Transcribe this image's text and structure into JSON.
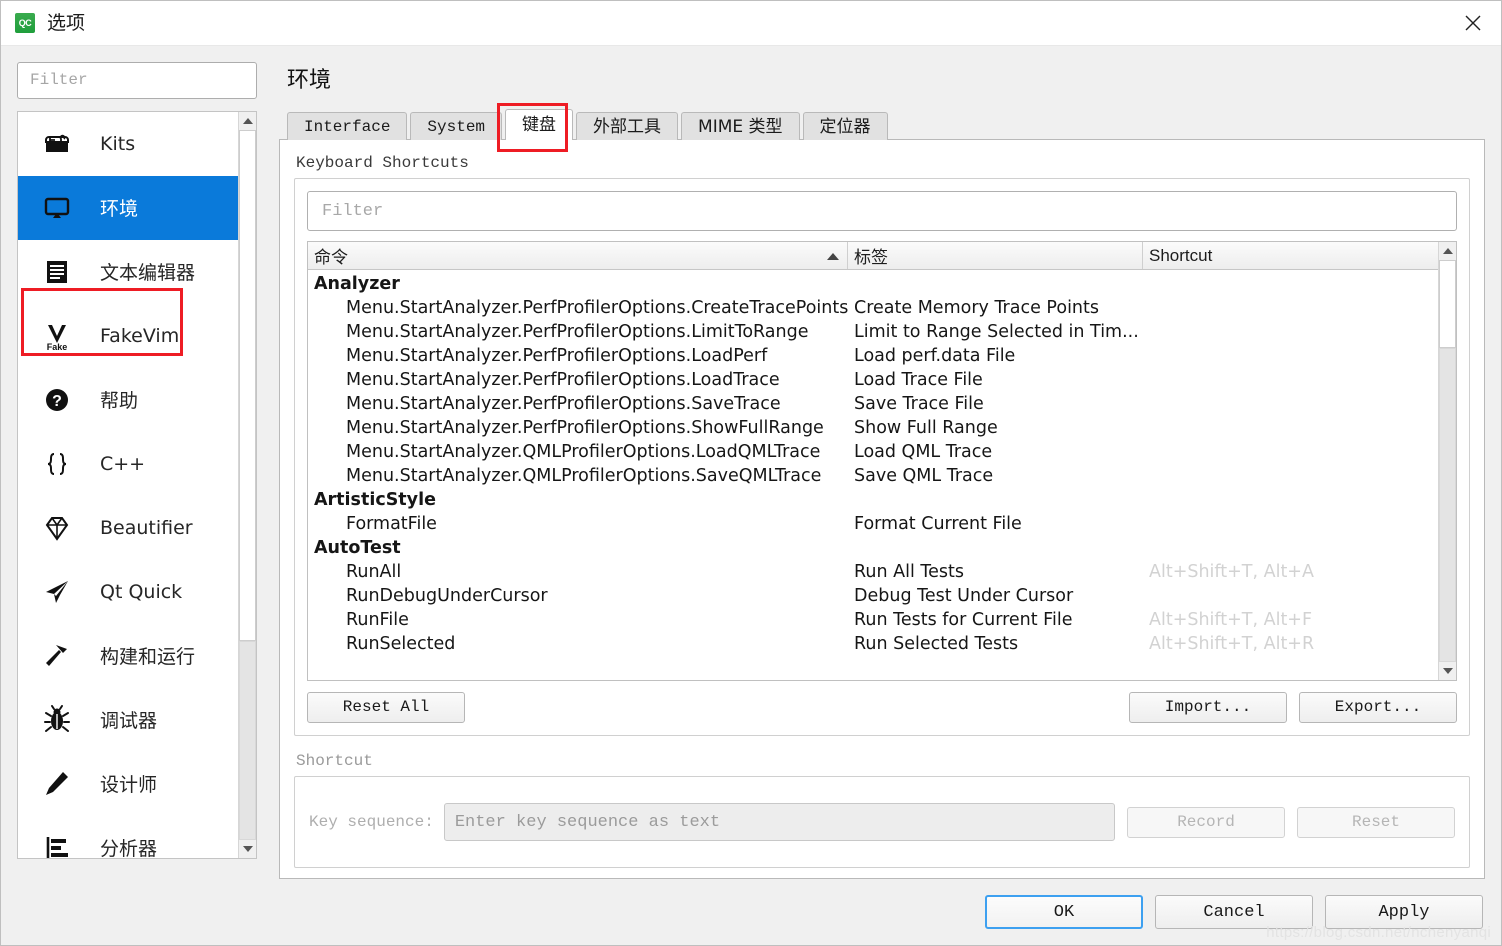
{
  "window": {
    "title": "选项",
    "app_icon_text": "QC",
    "close_icon": "close-icon"
  },
  "sidebar": {
    "filter_placeholder": "Filter",
    "selected_index": 1,
    "items": [
      {
        "label": "Kits",
        "icon": "kits-toolbox-icon"
      },
      {
        "label": "环境",
        "icon": "monitor-icon"
      },
      {
        "label": "文本编辑器",
        "icon": "document-lines-icon"
      },
      {
        "label": "FakeVim",
        "icon": "fakevim-icon"
      },
      {
        "label": "帮助",
        "icon": "question-mark-icon"
      },
      {
        "label": "C++",
        "icon": "curly-braces-icon"
      },
      {
        "label": "Beautifier",
        "icon": "diamond-icon"
      },
      {
        "label": "Qt Quick",
        "icon": "paper-plane-icon"
      },
      {
        "label": "构建和运行",
        "icon": "hammer-icon"
      },
      {
        "label": "调试器",
        "icon": "bug-icon"
      },
      {
        "label": "设计师",
        "icon": "pencil-icon"
      },
      {
        "label": "分析器",
        "icon": "bar-analysis-icon"
      }
    ]
  },
  "page": {
    "heading": "环境",
    "tabs": [
      {
        "label": "Interface",
        "cjk": false,
        "active": false
      },
      {
        "label": "System",
        "cjk": false,
        "active": false
      },
      {
        "label": "键盘",
        "cjk": true,
        "active": true
      },
      {
        "label": "外部工具",
        "cjk": true,
        "active": false
      },
      {
        "label": "MIME 类型",
        "cjk": true,
        "active": false
      },
      {
        "label": "定位器",
        "cjk": true,
        "active": false
      }
    ]
  },
  "shortcuts_group": {
    "label": "Keyboard Shortcuts",
    "filter_placeholder": "Filter",
    "columns": [
      "命令",
      "标签",
      "Shortcut"
    ],
    "sort_column": "命令",
    "sort_direction": "ascending",
    "rows": [
      {
        "type": "group",
        "command": "Analyzer",
        "tag": "",
        "shortcut": ""
      },
      {
        "type": "child",
        "command": "Menu.StartAnalyzer.PerfProfilerOptions.CreateTracePoints",
        "tag": "Create Memory Trace Points",
        "shortcut": ""
      },
      {
        "type": "child",
        "command": "Menu.StartAnalyzer.PerfProfilerOptions.LimitToRange",
        "tag": "Limit to Range Selected in Tim...",
        "shortcut": ""
      },
      {
        "type": "child",
        "command": "Menu.StartAnalyzer.PerfProfilerOptions.LoadPerf",
        "tag": "Load perf.data File",
        "shortcut": ""
      },
      {
        "type": "child",
        "command": "Menu.StartAnalyzer.PerfProfilerOptions.LoadTrace",
        "tag": "Load Trace File",
        "shortcut": ""
      },
      {
        "type": "child",
        "command": "Menu.StartAnalyzer.PerfProfilerOptions.SaveTrace",
        "tag": "Save Trace File",
        "shortcut": ""
      },
      {
        "type": "child",
        "command": "Menu.StartAnalyzer.PerfProfilerOptions.ShowFullRange",
        "tag": "Show Full Range",
        "shortcut": ""
      },
      {
        "type": "child",
        "command": "Menu.StartAnalyzer.QMLProfilerOptions.LoadQMLTrace",
        "tag": "Load QML Trace",
        "shortcut": ""
      },
      {
        "type": "child",
        "command": "Menu.StartAnalyzer.QMLProfilerOptions.SaveQMLTrace",
        "tag": "Save QML Trace",
        "shortcut": ""
      },
      {
        "type": "group",
        "command": "ArtisticStyle",
        "tag": "",
        "shortcut": ""
      },
      {
        "type": "child",
        "command": "FormatFile",
        "tag": "Format Current File",
        "shortcut": ""
      },
      {
        "type": "group",
        "command": "AutoTest",
        "tag": "",
        "shortcut": ""
      },
      {
        "type": "child",
        "command": "RunAll",
        "tag": "Run All Tests",
        "shortcut": "Alt+Shift+T, Alt+A"
      },
      {
        "type": "child",
        "command": "RunDebugUnderCursor",
        "tag": "Debug Test Under Cursor",
        "shortcut": ""
      },
      {
        "type": "child",
        "command": "RunFile",
        "tag": "Run Tests for Current File",
        "shortcut": "Alt+Shift+T, Alt+F"
      },
      {
        "type": "child",
        "command": "RunSelected",
        "tag": "Run Selected Tests",
        "shortcut": "Alt+Shift+T, Alt+R"
      }
    ],
    "reset_all_label": "Reset All",
    "import_label": "Import...",
    "export_label": "Export..."
  },
  "shortcut_section": {
    "label": "Shortcut",
    "key_sequence_label": "Key sequence:",
    "key_sequence_placeholder": "Enter key sequence as text",
    "key_sequence_value": "",
    "record_label": "Record",
    "reset_label": "Reset"
  },
  "footer": {
    "ok_label": "OK",
    "cancel_label": "Cancel",
    "apply_label": "Apply",
    "watermark": "https://blog.csdn.net/nchenyanqi"
  },
  "colors": {
    "selection_blue": "#0a7ada",
    "annotation_red": "#ee1c24",
    "app_icon_green": "#2ea043",
    "focus_blue": "#3da0f0"
  }
}
